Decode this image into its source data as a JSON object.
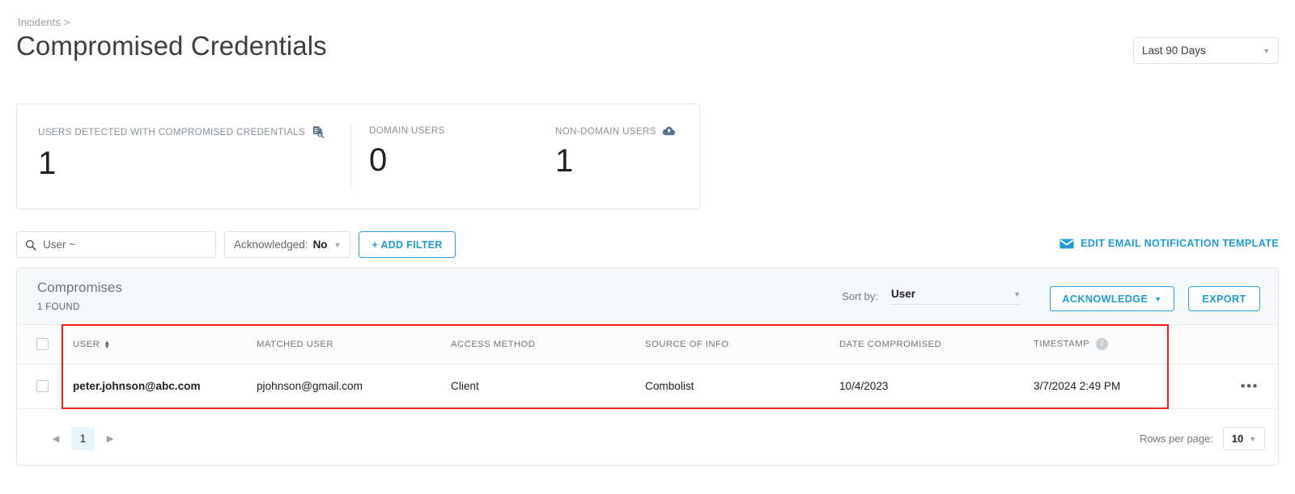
{
  "header": {
    "breadcrumb": "Incidents >",
    "title": "Compromised Credentials",
    "date_range": "Last 90 Days",
    "date_range_caret": "▼"
  },
  "stats": [
    {
      "label": "USERS DETECTED WITH COMPROMISED CREDENTIALS",
      "value": "1",
      "icon": "document-search-icon"
    },
    {
      "label": "DOMAIN USERS",
      "value": "0",
      "icon": ""
    },
    {
      "label": "NON-DOMAIN USERS",
      "value": "1",
      "icon": "cloud-upload-icon"
    }
  ],
  "filters": {
    "search_value": "User ~",
    "search_icon": "search-icon",
    "acknowledged_prefix": "Acknowledged:",
    "acknowledged_value": "No",
    "caret": "▼",
    "add_filter_label": "+ ADD FILTER",
    "edit_template_label": "EDIT EMAIL NOTIFICATION TEMPLATE",
    "edit_template_icon": "envelope-icon"
  },
  "table": {
    "title": "Compromises",
    "found": "1 FOUND",
    "sort_by_label": "Sort by:",
    "sort_by_value": "User",
    "acknowledge_label": "ACKNOWLEDGE",
    "acknowledge_caret": "▼",
    "export_label": "EXPORT",
    "columns": [
      {
        "key": "user",
        "label": "USER",
        "sortable": true
      },
      {
        "key": "matched_user",
        "label": "MATCHED USER",
        "sortable": false
      },
      {
        "key": "access_method",
        "label": "ACCESS METHOD",
        "sortable": false
      },
      {
        "key": "source_of_info",
        "label": "SOURCE OF INFO",
        "sortable": false
      },
      {
        "key": "date_compromised",
        "label": "DATE COMPROMISED",
        "sortable": false
      },
      {
        "key": "timestamp",
        "label": "TIMESTAMP",
        "sortable": false,
        "info": "i"
      }
    ],
    "rows": [
      {
        "user": "peter.johnson@abc.com",
        "matched_user": "pjohnson@gmail.com",
        "access_method": "Client",
        "source_of_info": "Combolist",
        "date_compromised": "10/4/2023",
        "timestamp": "3/7/2024 2:49 PM",
        "menu": "•••"
      }
    ]
  },
  "pagination": {
    "prev": "◀",
    "next": "▶",
    "current_page": "1",
    "rows_per_page_label": "Rows per page:",
    "rows_per_page_value": "10",
    "caret": "▼"
  },
  "colors": {
    "accent": "#1f9bd8",
    "annotation": "#f41c1c",
    "icon_blue": "#5b7189",
    "page_active_bg": "#e8f4fb"
  }
}
